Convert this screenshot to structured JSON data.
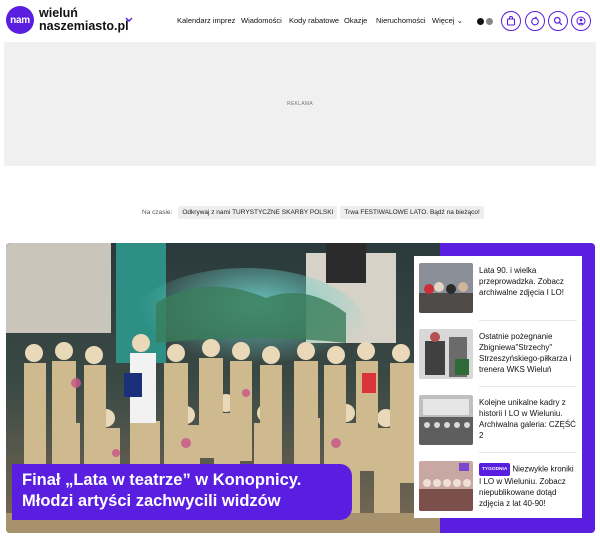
{
  "brand": {
    "logo_badge": "nam",
    "name_line1": "wieluń",
    "name_line2": "naszemiasto.pl"
  },
  "nav": {
    "items": [
      {
        "label": "Kalendarz imprez"
      },
      {
        "label": "Wiadomości"
      },
      {
        "label": "Kody rabatowe"
      },
      {
        "label": "Okazje"
      },
      {
        "label": "Nieruchomości"
      },
      {
        "label": "Więcej ⌄"
      }
    ]
  },
  "header_icons": [
    "theme-toggle-icon",
    "shopping-bag-icon",
    "news-icon",
    "search-icon",
    "user-icon"
  ],
  "ad": {
    "label": "REKLAMA"
  },
  "trending": {
    "label": "Na czasie:",
    "chips": [
      {
        "label": "Odkrywaj z nami TURYSTYCZNE SKARBY POLSKI"
      },
      {
        "label": "Trwa FESTIWALOWE LATO. Bądź na bieżąco!"
      }
    ]
  },
  "hero": {
    "title": "Finał „Lata w teatrze” w Konopnicy. Młodzi artyści zachwycili widzów"
  },
  "side_articles": [
    {
      "title": "Lata 90. i wielka przeprowadzka. Zobacz archiwalne zdjęcia I LO!",
      "badge": ""
    },
    {
      "title": "Ostatnie pożegnanie Zbigniewa\"Strzechy\" Strzeszyńskiego-piłkarza i trenera WKS Wieluń",
      "badge": ""
    },
    {
      "title": "Kolejne unikalne kadry z historii I LO w Wieluniu. Archiwalna galeria: CZĘŚĆ 2",
      "badge": ""
    },
    {
      "title": "Niezwykle kroniki I LO w Wieluniu. Zobacz niepublikowane dotąd zdjęcia z lat 40-90!",
      "badge": "TYGODNIA"
    }
  ],
  "colors": {
    "accent": "#5a1ee0",
    "ad_bg": "#f0f0f0",
    "chip_bg": "#eeeeee"
  }
}
